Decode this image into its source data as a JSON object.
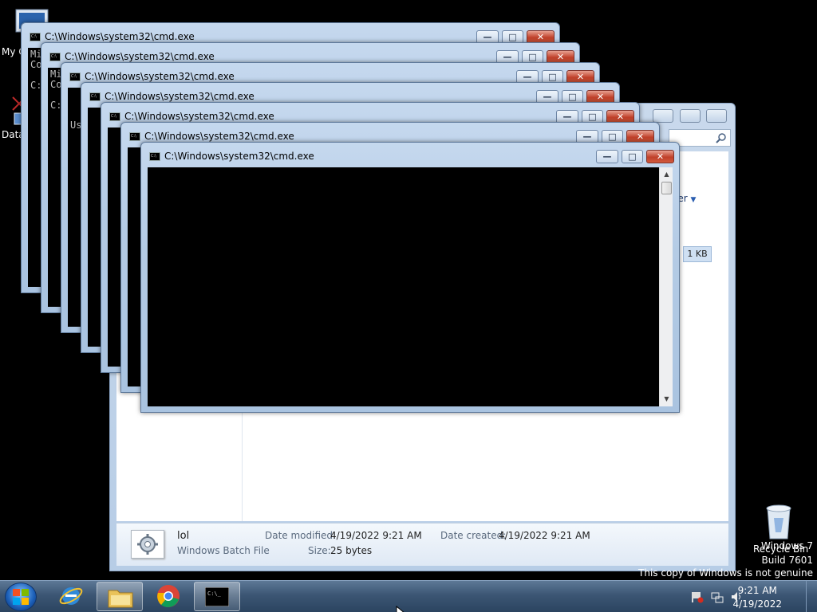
{
  "desktop": {
    "icons": [
      {
        "label": "My C"
      },
      {
        "label": "Data"
      }
    ],
    "recycle_bin": "Recycle Bin"
  },
  "cmd_windows": [
    {
      "title": "C:\\Windows\\system32\\cmd.exe",
      "lines": [
        "Mi",
        "Co",
        "",
        "C:"
      ]
    },
    {
      "title": "C:\\Windows\\system32\\cmd.exe",
      "lines": [
        "Mi",
        "Co",
        "",
        "C:"
      ]
    },
    {
      "title": "C:\\Windows\\system32\\cmd.exe",
      "lines": [
        "",
        "",
        "",
        "Us"
      ]
    },
    {
      "title": "C:\\Windows\\system32\\cmd.exe",
      "lines": []
    },
    {
      "title": "C:\\Windows\\system32\\cmd.exe",
      "lines": []
    },
    {
      "title": "C:\\Windows\\system32\\cmd.exe",
      "lines": []
    },
    {
      "title": "C:\\Windows\\system32\\cmd.exe",
      "lines": []
    }
  ],
  "explorer": {
    "toolbar_button": "ler",
    "help_label": "?",
    "file_size": "1 KB",
    "details": {
      "name": "lol",
      "type": "Windows Batch File",
      "date_modified_label": "Date modified:",
      "date_modified": "4/19/2022 9:21 AM",
      "date_created_label": "Date created:",
      "date_created": "4/19/2022 9:21 AM",
      "size_label": "Size:",
      "size": "25 bytes"
    }
  },
  "watermark": {
    "line1": "Windows 7",
    "line2": "Build 7601",
    "line3": "This copy of Windows is not genuine"
  },
  "taskbar": {
    "time": "9:21 AM",
    "date": "4/19/2022",
    "pinned": [
      "internet-explorer",
      "windows-explorer",
      "google-chrome",
      "command-prompt"
    ]
  }
}
